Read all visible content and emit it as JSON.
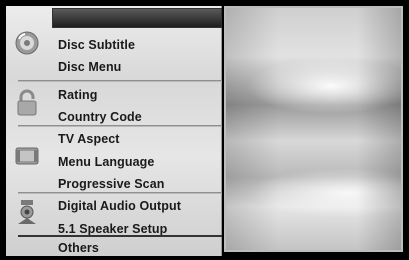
{
  "menu": {
    "items": [
      {
        "label": "Disc Subtitle",
        "dim": false
      },
      {
        "label": "Disc Menu",
        "dim": false
      },
      {
        "label": "Rating",
        "dim": false
      },
      {
        "label": "Country Code",
        "dim": false
      },
      {
        "label": "TV Aspect",
        "dim": false
      },
      {
        "label": "Menu Language",
        "dim": false
      },
      {
        "label": "Progressive Scan",
        "dim": false
      },
      {
        "label": "Digital Audio Output",
        "dim": false
      },
      {
        "label": "5.1 Speaker Setup",
        "dim": false
      },
      {
        "label": "Others",
        "dim": false
      }
    ]
  },
  "icons": [
    "disc-icon",
    "lock-icon",
    "display-icon",
    "speaker-icon"
  ]
}
